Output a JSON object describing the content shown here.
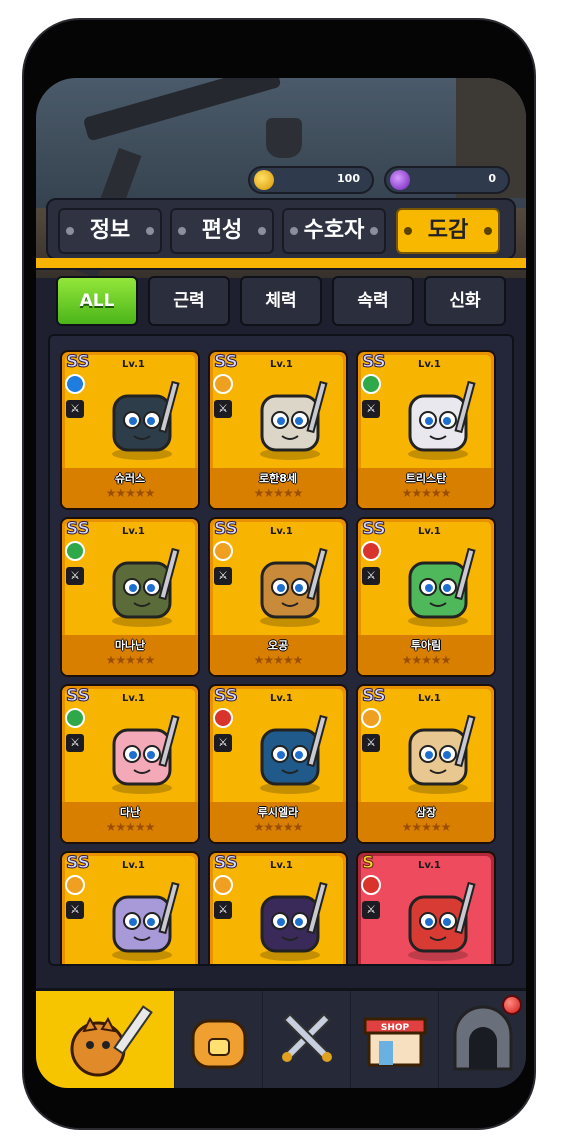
{
  "currency": {
    "gold": {
      "value": "100",
      "icon": "gold-coin-icon",
      "color": "#f0b400"
    },
    "gem": {
      "value": "0",
      "icon": "purple-gem-icon",
      "color": "#8a3ad9"
    }
  },
  "tabs": [
    {
      "label": "정보",
      "active": false
    },
    {
      "label": "편성",
      "active": false
    },
    {
      "label": "수호자",
      "active": false
    },
    {
      "label": "도감",
      "active": true
    }
  ],
  "filters": [
    {
      "label": "ALL",
      "active": true
    },
    {
      "label": "근력",
      "active": false
    },
    {
      "label": "체력",
      "active": false
    },
    {
      "label": "속력",
      "active": false
    },
    {
      "label": "신화",
      "active": false
    }
  ],
  "cards": [
    {
      "rank": "SS",
      "level": "Lv.1",
      "name": "슈러스",
      "element": "#1f7de0",
      "element_icon": "wind-element-icon",
      "class_icon": "shield-class-icon",
      "stars": "★★★★★",
      "art": "#2e3d4a"
    },
    {
      "rank": "SS",
      "level": "Lv.1",
      "name": "로한8세",
      "element": "#f0a020",
      "element_icon": "light-element-icon",
      "class_icon": "shield-class-icon",
      "stars": "★★★★★",
      "art": "#dcd6c8"
    },
    {
      "rank": "SS",
      "level": "Lv.1",
      "name": "트리스탄",
      "element": "#2fa84a",
      "element_icon": "nature-element-icon",
      "class_icon": "sword-class-icon",
      "stars": "★★★★★",
      "art": "#e8e8ee"
    },
    {
      "rank": "SS",
      "level": "Lv.1",
      "name": "마나난",
      "element": "#2fa84a",
      "element_icon": "nature-element-icon",
      "class_icon": "sword-class-icon",
      "stars": "★★★★★",
      "art": "#5b6b3a"
    },
    {
      "rank": "SS",
      "level": "Lv.1",
      "name": "오공",
      "element": "#f0a020",
      "element_icon": "light-element-icon",
      "class_icon": "sword-class-icon",
      "stars": "★★★★★",
      "art": "#c98a3a"
    },
    {
      "rank": "SS",
      "level": "Lv.1",
      "name": "투아림",
      "element": "#d8342c",
      "element_icon": "fire-element-icon",
      "class_icon": "bow-class-icon",
      "stars": "★★★★★",
      "art": "#4fb85a"
    },
    {
      "rank": "SS",
      "level": "Lv.1",
      "name": "다난",
      "element": "#2fa84a",
      "element_icon": "nature-element-icon",
      "class_icon": "staff-class-icon",
      "stars": "★★★★★",
      "art": "#f4a9b8"
    },
    {
      "rank": "SS",
      "level": "Lv.1",
      "name": "루시엘라",
      "element": "#d8342c",
      "element_icon": "fire-element-icon",
      "class_icon": "staff-class-icon",
      "stars": "★★★★★",
      "art": "#1f5a8a"
    },
    {
      "rank": "SS",
      "level": "Lv.1",
      "name": "삼장",
      "element": "#f0a020",
      "element_icon": "light-element-icon",
      "class_icon": "staff-class-icon",
      "stars": "★★★★★",
      "art": "#e8c890"
    },
    {
      "rank": "SS",
      "level": "Lv.1",
      "name": "",
      "element": "#f0a020",
      "element_icon": "light-element-icon",
      "class_icon": "swirl-class-icon",
      "stars": "",
      "art": "#a89ad8"
    },
    {
      "rank": "SS",
      "level": "Lv.1",
      "name": "",
      "element": "#f0a020",
      "element_icon": "light-element-icon",
      "class_icon": "cross-sword-class-icon",
      "stars": "",
      "art": "#3a2a5a"
    },
    {
      "rank": "S",
      "level": "Lv.1",
      "name": "",
      "element": "#d8342c",
      "element_icon": "fire-element-icon",
      "class_icon": "shield-class-icon",
      "stars": "",
      "art": "#d83a34",
      "red": true
    }
  ],
  "nav": [
    {
      "name": "nav-heroes",
      "icon": "tiger-hero-icon",
      "active": true
    },
    {
      "name": "nav-bag",
      "icon": "backpack-icon",
      "active": false
    },
    {
      "name": "nav-battle",
      "icon": "crossed-swords-icon",
      "active": false
    },
    {
      "name": "nav-shop",
      "icon": "shop-icon",
      "active": false,
      "label": "SHOP"
    },
    {
      "name": "nav-dungeon",
      "icon": "dungeon-gate-icon",
      "active": false
    }
  ]
}
